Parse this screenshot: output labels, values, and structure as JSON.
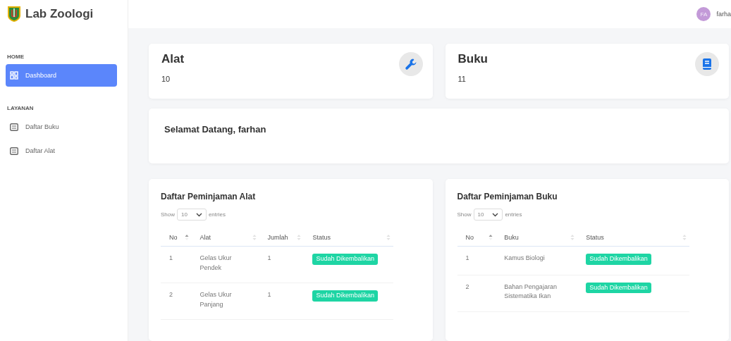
{
  "brand": {
    "title": "Lab Zoologi"
  },
  "user": {
    "initials": "FA",
    "name": "farha"
  },
  "sidebar": {
    "sections": [
      {
        "heading": "HOME",
        "items": [
          {
            "label": "Dashboard",
            "kind": "grid",
            "selected": true
          }
        ]
      },
      {
        "heading": "LAYANAN",
        "items": [
          {
            "label": "Daftar Buku",
            "kind": "list",
            "selected": false
          },
          {
            "label": "Daftar Alat",
            "kind": "list",
            "selected": false
          }
        ]
      }
    ]
  },
  "stats": [
    {
      "title": "Alat",
      "value": "10",
      "kind": "wrench"
    },
    {
      "title": "Buku",
      "value": "11",
      "kind": "book"
    }
  ],
  "welcome": "Selamat Datang, farhan",
  "tables": [
    {
      "title": "Daftar Peminjaman Alat",
      "show": "Show",
      "page_size": "10",
      "entries": "entries",
      "columns": [
        {
          "label": "No",
          "sorted": true
        },
        {
          "label": "Alat",
          "sorted": false
        },
        {
          "label": "Jumlah",
          "sorted": false
        },
        {
          "label": "Status",
          "sorted": false
        }
      ],
      "rows": [
        [
          "1",
          "Gelas Ukur Pendek",
          "1",
          "Sudah Dikembalikan"
        ],
        [
          "2",
          "Gelas Ukur Panjang",
          "1",
          "Sudah Dikembalikan"
        ]
      ]
    },
    {
      "title": "Daftar Peminjaman Buku",
      "show": "Show",
      "page_size": "10",
      "entries": "entries",
      "columns": [
        {
          "label": "No",
          "sorted": true
        },
        {
          "label": "Buku",
          "sorted": false
        },
        {
          "label": "Status",
          "sorted": false
        }
      ],
      "rows": [
        [
          "1",
          "Kamus Biologi",
          "Sudah Dikembalikan"
        ],
        [
          "2",
          "Bahan Pengajaran Sistematika Ikan",
          "Sudah Dikembalikan"
        ]
      ]
    }
  ]
}
